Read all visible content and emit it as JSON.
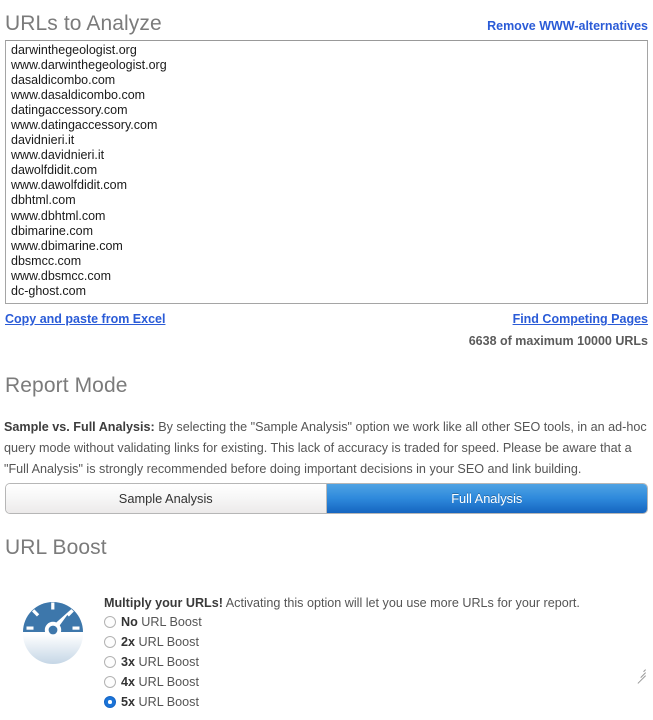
{
  "urls_section": {
    "heading": "URLs to Analyze",
    "remove_www_link": "Remove WWW-alternatives",
    "textarea_value": "darwinthegeologist.org\nwww.darwinthegeologist.org\ndasaldicombo.com\nwww.dasaldicombo.com\ndatingaccessory.com\nwww.datingaccessory.com\ndavidnieri.it\nwww.davidnieri.it\ndawolfdidit.com\nwww.dawolfdidit.com\ndbhtml.com\nwww.dbhtml.com\ndbimarine.com\nwww.dbimarine.com\ndbsmcc.com\nwww.dbsmcc.com\ndc-ghost.com",
    "textarea_lines": [
      "darwinthegeologist.org",
      "www.darwinthegeologist.org",
      "dasaldicombo.com",
      "www.dasaldicombo.com",
      "datingaccessory.com",
      "www.datingaccessory.com",
      "davidnieri.it",
      "www.davidnieri.it",
      "dawolfdidit.com",
      "www.dawolfdidit.com",
      "dbhtml.com",
      "www.dbhtml.com",
      "dbimarine.com",
      "www.dbimarine.com",
      "dbsmcc.com",
      "www.dbsmcc.com",
      "dc-ghost.com"
    ],
    "copy_paste_link": "Copy and paste from Excel",
    "find_competing_link": "Find Competing Pages",
    "url_count_text": "6638 of maximum 10000 URLs",
    "url_count_current": 6638,
    "url_count_maximum": 10000
  },
  "report_mode": {
    "heading": "Report Mode",
    "description_lead": "Sample vs. Full Analysis:",
    "description_body": " By selecting the \"Sample Analysis\" option we work like all other SEO tools, in an ad-hoc query mode without validating links for existing. This lack of accuracy is traded for speed. Please be aware that a \"Full Analysis\" is strongly recommended before doing important decisions in your SEO and link building.",
    "options": [
      {
        "label": "Sample Analysis",
        "selected": false
      },
      {
        "label": "Full Analysis",
        "selected": true
      }
    ],
    "sample_label": "Sample Analysis",
    "full_label": "Full Analysis"
  },
  "url_boost": {
    "heading": "URL Boost",
    "icon": "speedometer-icon",
    "lead": "Multiply your URLs!",
    "description": " Activating this option will let you use more URLs for your report.",
    "options": [
      {
        "prefix": "No",
        "label": " URL Boost",
        "selected": false
      },
      {
        "prefix": "2x",
        "label": " URL Boost",
        "selected": false
      },
      {
        "prefix": "3x",
        "label": " URL Boost",
        "selected": false
      },
      {
        "prefix": "4x",
        "label": " URL Boost",
        "selected": false
      },
      {
        "prefix": "5x",
        "label": " URL Boost",
        "selected": true
      }
    ]
  },
  "colors": {
    "link_blue": "#2a5bd7",
    "active_button_blue": "#2f8adc",
    "heading_gray": "#7b7b7b",
    "body_gray": "#555555",
    "icon_blue": "#3d77ab",
    "radio_selected_blue": "#1b74d8"
  }
}
